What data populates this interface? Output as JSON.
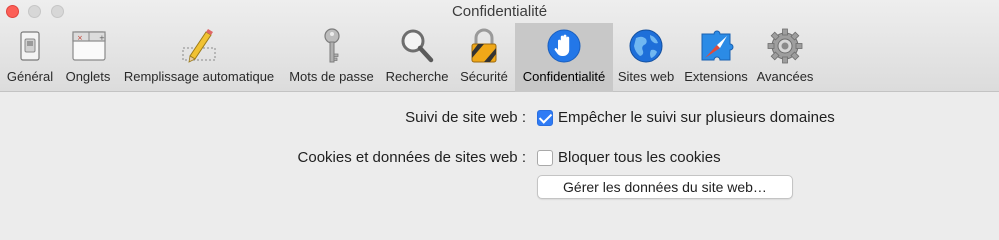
{
  "window": {
    "title": "Confidentialité"
  },
  "toolbar": {
    "tabs": [
      {
        "label": "Général",
        "icon": "general-switch-icon"
      },
      {
        "label": "Onglets",
        "icon": "tabs-icon"
      },
      {
        "label": "Remplissage automatique",
        "icon": "pencil-autofill-icon"
      },
      {
        "label": "Mots de passe",
        "icon": "key-icon"
      },
      {
        "label": "Recherche",
        "icon": "magnifier-icon"
      },
      {
        "label": "Sécurité",
        "icon": "padlock-icon"
      },
      {
        "label": "Confidentialité",
        "icon": "hand-icon",
        "selected": true
      },
      {
        "label": "Sites web",
        "icon": "globe-icon"
      },
      {
        "label": "Extensions",
        "icon": "puzzle-compass-icon"
      },
      {
        "label": "Avancées",
        "icon": "gear-icon"
      }
    ]
  },
  "privacy": {
    "tracking_label": "Suivi de site web :",
    "tracking_checkbox_label": "Empêcher le suivi sur plusieurs domaines",
    "tracking_checked": true,
    "cookies_label": "Cookies et données de sites web :",
    "cookies_checkbox_label": "Bloquer tous les cookies",
    "cookies_checked": false,
    "manage_button_label": "Gérer les données du site web…"
  },
  "colors": {
    "accent": "#2f7bf5",
    "selected_tab_bg": "#c8c8c8",
    "close_button": "#fc5f57"
  }
}
